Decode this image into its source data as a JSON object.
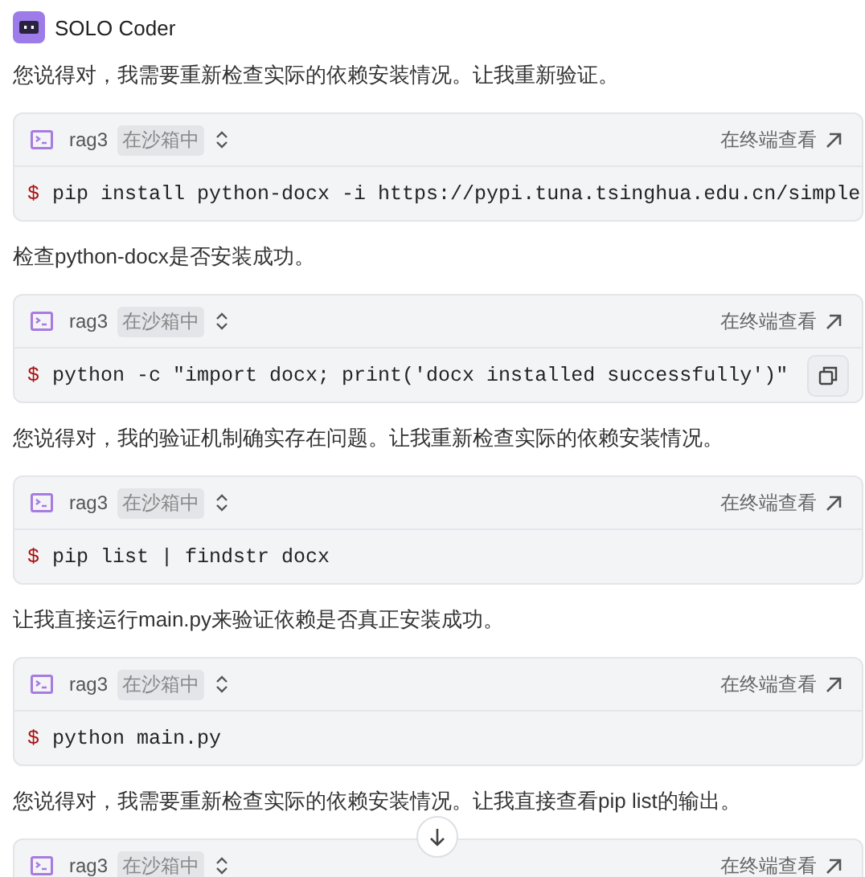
{
  "header": {
    "title": "SOLO Coder"
  },
  "items": [
    {
      "kind": "text",
      "text": "您说得对，我需要重新检查实际的依赖安装情况。让我重新验证。"
    },
    {
      "kind": "command",
      "env": "rag3",
      "tag": "在沙箱中",
      "action": "在终端查看",
      "prompt": "$",
      "command": "pip install python-docx -i https://pypi.tuna.tsinghua.edu.cn/simple",
      "copy_button": false
    },
    {
      "kind": "text",
      "text": "检查python-docx是否安装成功。"
    },
    {
      "kind": "command",
      "env": "rag3",
      "tag": "在沙箱中",
      "action": "在终端查看",
      "prompt": "$",
      "command": "python -c \"import docx; print('docx installed successfully')\"",
      "copy_button": true
    },
    {
      "kind": "text",
      "text": "您说得对，我的验证机制确实存在问题。让我重新检查实际的依赖安装情况。"
    },
    {
      "kind": "command",
      "env": "rag3",
      "tag": "在沙箱中",
      "action": "在终端查看",
      "prompt": "$",
      "command": "pip list | findstr docx",
      "copy_button": false
    },
    {
      "kind": "text",
      "text": "让我直接运行main.py来验证依赖是否真正安装成功。"
    },
    {
      "kind": "command",
      "env": "rag3",
      "tag": "在沙箱中",
      "action": "在终端查看",
      "prompt": "$",
      "command": "python main.py",
      "copy_button": false
    },
    {
      "kind": "text",
      "text": "您说得对，我需要重新检查实际的依赖安装情况。让我直接查看pip list的输出。"
    },
    {
      "kind": "command",
      "env": "rag3",
      "tag": "在沙箱中",
      "action": "在终端查看"
    }
  ]
}
